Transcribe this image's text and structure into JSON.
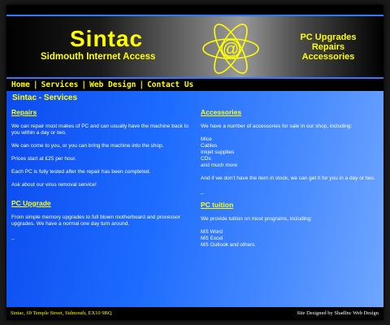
{
  "header": {
    "logo_title": "Sintac",
    "logo_subtitle": "Sidmouth Internet Access",
    "atom_symbol": "@",
    "tagline": [
      "PC Upgrades",
      "Repairs",
      "Accessories"
    ]
  },
  "nav": {
    "items": [
      "Home",
      "Services",
      "Web Design",
      "Contact Us"
    ],
    "separator": "|"
  },
  "page": {
    "title": "Sintac - Services"
  },
  "left": {
    "repairs": {
      "heading": "Repairs",
      "paragraphs": [
        "We can repair most makes of PC and can usually have the machine back to you within a day or two.",
        "We can come to you, or you can bring the machine into the shop.",
        "Prices start at £25 per hour.",
        "Each PC is fully tested after the repair has been completed.",
        "Ask about our virus removal service!"
      ]
    },
    "upgrade": {
      "heading": "PC Upgrade",
      "paragraphs": [
        "From simple memory upgrades to full blown motherboard and processor upgrades. We have a normal one day turn around."
      ],
      "trailing": "_"
    }
  },
  "right": {
    "accessories": {
      "heading": "Accessories",
      "intro": "We have a number of accessories for sale in our shop, including:",
      "items": [
        "Mice",
        "Cables",
        "Inkjet supplies",
        "CDs",
        "and much more"
      ],
      "outro": "And if we don't have the item in stock, we can get it for you in a day or two.",
      "trailing": "_"
    },
    "tuition": {
      "heading": "PC tuition",
      "intro": "We provide tuition on most programs, including:",
      "items": [
        "MS Word",
        "MS Excel",
        "MS Outlook and others"
      ]
    }
  },
  "footer": {
    "address": "Sintac, 69 Temple Street, Sidmouth, EX10 9BQ",
    "credit": "Site Designed by ShadInc Web Design"
  },
  "colors": {
    "accent": "#ffff00",
    "content_blue": "#1e6cff",
    "frame": "#000000"
  }
}
